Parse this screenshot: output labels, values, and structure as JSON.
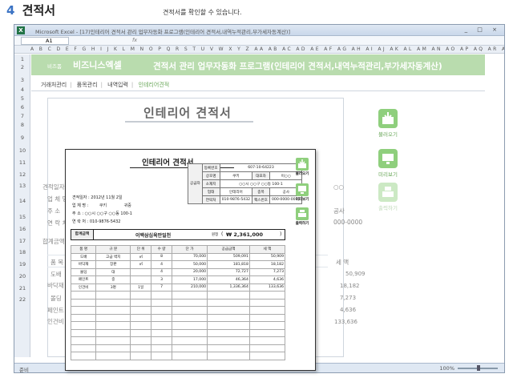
{
  "heading": {
    "number": "4",
    "title": "견적서"
  },
  "caption": "견적서를 확인할 수 있습니다.",
  "excel": {
    "window_title": "Microsoft Excel - [17)인테리어 견적서 관리 업무자동화 프로그램(인테리어 견적서,내역누적관리,부가세자동계산)]",
    "window_buttons": "_ □ ×",
    "name_box": "A1",
    "fx_label": "fx",
    "column_headers": "A B C D E F G H I J K L M N O P Q R S T U V W X Y Z AA AB AC AD AE AF AG AH AI AJ AK AL AM AN AO AP AQ AR AS AT AU AV AW AX AY AZ",
    "row_numbers": [
      "1",
      "2",
      "3",
      "4",
      "5",
      "6",
      "7",
      "8",
      "9",
      "10",
      "11",
      "12",
      "13",
      "14",
      "15",
      "16",
      "17",
      "18",
      "19",
      "20",
      "21",
      "22"
    ],
    "status_ready": "준비",
    "zoom": "100%",
    "zoom_level_percent": 100
  },
  "sheet": {
    "brand_small": "비즈폼",
    "brand": "비즈니스엑셀",
    "program_title": "견적서 관리 업무자동화 프로그램(인테리어 견적서,내역누적관리,부가세자동계산)",
    "nav": {
      "tab1": "거래처관리",
      "tab2": "품목관리",
      "tab3": "내역입력",
      "tab4": "인테리어견적"
    },
    "bg_title": "인테리어 견적서",
    "bg_labels": [
      "견적일자",
      "업 체 명",
      "주 소",
      "연 락 처",
      "합계금액"
    ],
    "bg_headers": {
      "col1": "품 목",
      "col2": "세 액"
    },
    "bg_items": [
      "도배",
      "바닥재",
      "몰딩",
      "페인트",
      "인건비"
    ],
    "bg_tax": [
      "50,909",
      "18,182",
      "7,273",
      "4,636",
      "133,636"
    ],
    "bg_right": [
      "○○",
      "공사",
      "000-0000"
    ],
    "side_buttons": {
      "load": "불러오기",
      "preview": "미리보기",
      "print": "출력하기"
    }
  },
  "popup": {
    "title": "인테리어 견적서",
    "date_line": "견적일자 : 2012년 11월 2일",
    "company_label": "업 체 명 :",
    "company_value": "쿠키",
    "honorific": "귀중",
    "address_label": "주   소 :",
    "address_value": "○○시 ○○구 ○○동 100-1",
    "contact_label": "연 락 처 :",
    "contact_value": "010-9876-5432",
    "vendor": {
      "side_label": "공급자",
      "reg_label": "등록번호",
      "reg_value": "607-10-64223",
      "name_label": "상호명",
      "name_value": "쿠키",
      "rep_label": "대표자",
      "rep_value": "이○○",
      "addr_label": "소재지",
      "addr_value": "○○시 ○○구 ○○동 100-1",
      "biz_label": "업태",
      "biz_value": "인테리어",
      "type_label": "종목",
      "type_value": "공사",
      "tel_label": "연락처",
      "tel_value": "010-9876-5432",
      "fax_label": "팩스번호",
      "fax_value": "000-0000-0000"
    },
    "total": {
      "label": "합계금액",
      "words": "이백삼십육만일천",
      "won": "원정",
      "paren_open": "(",
      "amount": "₩ 2,361,000",
      "paren_close": ")"
    },
    "table_headers": [
      "품 명",
      "규 분",
      "단 위",
      "수 량",
      "단 가",
      "공급금액",
      "세 액"
    ],
    "rows": [
      [
        "도배",
        "고급 벽지",
        "㎡",
        "8",
        "70,000",
        "509,091",
        "50,909"
      ],
      [
        "바닥재",
        "장판",
        "㎡",
        "4",
        "50,000",
        "181,818",
        "18,182"
      ],
      [
        "몰딩",
        "대",
        "",
        "4",
        "20,000",
        "72,727",
        "7,273"
      ],
      [
        "페인트",
        "중",
        "",
        "3",
        "17,000",
        "46,364",
        "4,636"
      ],
      [
        "인건비",
        "3명",
        "1일",
        "7",
        "210,000",
        "1,336,364",
        "133,636"
      ]
    ],
    "empty_row_count": 9,
    "buttons": {
      "load": "불러오기",
      "preview": "미리보기",
      "print": "출력하기"
    }
  },
  "colors": {
    "accent_green": "#6ba85b",
    "banner_green": "#b9dcae",
    "heading_blue": "#3b73c4"
  }
}
